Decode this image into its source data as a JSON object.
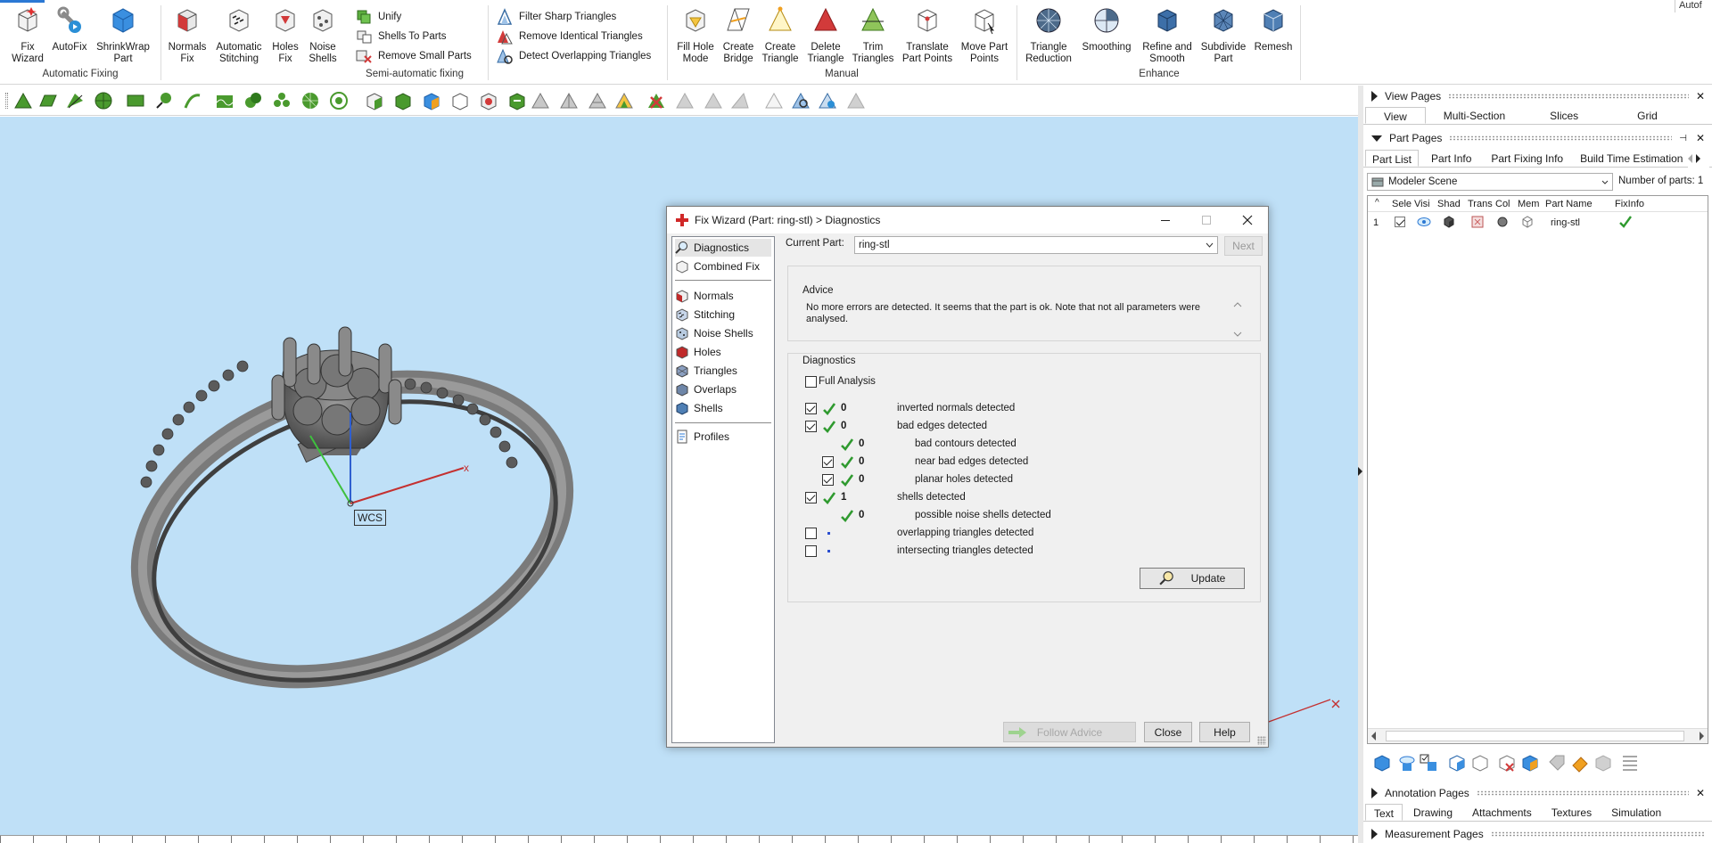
{
  "ribbon": {
    "corner_label": "Autof",
    "automatic": {
      "group_label": "Automatic Fixing",
      "fix_wizard": "Fix Wizard",
      "autofix": "AutoFix",
      "shrinkwrap": "ShrinkWrap Part"
    },
    "semi": {
      "group_label": "Semi-automatic fixing",
      "normals_fix": "Normals Fix",
      "auto_stitching": "Automatic Stitching",
      "holes_fix": "Holes Fix",
      "noise_shells": "Noise Shells",
      "unify": "Unify",
      "shells_to_parts": "Shells To Parts",
      "remove_small_parts": "Remove Small Parts",
      "filter_sharp": "Filter Sharp Triangles",
      "remove_identical": "Remove Identical Triangles",
      "detect_overlapping": "Detect Overlapping Triangles"
    },
    "manual": {
      "group_label": "Manual",
      "fill_hole_mode": "Fill Hole Mode",
      "create_bridge": "Create Bridge",
      "create_triangle": "Create Triangle",
      "delete_triangle": "Delete Triangle",
      "trim_triangles": "Trim Triangles",
      "translate_points": "Translate Part Points",
      "move_points": "Move Part Points"
    },
    "enhance": {
      "group_label": "Enhance",
      "triangle_reduction": "Triangle Reduction",
      "smoothing": "Smoothing",
      "refine_smooth": "Refine and Smooth",
      "subdivide": "Subdivide Part",
      "remesh": "Remesh"
    }
  },
  "viewport": {
    "wcs_label": "WCS",
    "x_axis_label": "x",
    "colors": {
      "background": "#bfe0f7",
      "ring": "#6e6e6e"
    }
  },
  "dialog": {
    "title": "Fix Wizard (Part: ring-stl) > Diagnostics",
    "nav": {
      "diagnostics": "Diagnostics",
      "combined_fix": "Combined Fix",
      "normals": "Normals",
      "stitching": "Stitching",
      "noise_shells": "Noise Shells",
      "holes": "Holes",
      "triangles": "Triangles",
      "overlaps": "Overlaps",
      "shells": "Shells",
      "profiles": "Profiles"
    },
    "current_part_label": "Current Part:",
    "current_part_value": "ring-stl",
    "next_label": "Next",
    "advice_label": "Advice",
    "advice_text": "No more errors are detected. It seems that the part is ok. Note that not all parameters were analysed.",
    "diagnostics_label": "Diagnostics",
    "full_analysis_label": "Full Analysis",
    "rows": [
      {
        "value": "0",
        "label": "inverted normals detected"
      },
      {
        "value": "0",
        "label": "bad edges detected"
      },
      {
        "value": "0",
        "label": "bad contours detected"
      },
      {
        "value": "0",
        "label": "near bad edges detected"
      },
      {
        "value": "0",
        "label": "planar holes detected"
      },
      {
        "value": "1",
        "label": "shells detected"
      },
      {
        "value": "0",
        "label": "possible noise shells detected"
      },
      {
        "value": "",
        "label": "overlapping triangles detected"
      },
      {
        "value": "",
        "label": "intersecting triangles detected"
      }
    ],
    "update_label": "Update",
    "follow_advice_label": "Follow Advice",
    "close_label": "Close",
    "help_label": "Help"
  },
  "right_panel": {
    "view_pages": {
      "header": "View Pages",
      "tabs": [
        "View",
        "Multi-Section",
        "Slices",
        "Grid"
      ]
    },
    "part_pages": {
      "header": "Part Pages",
      "tabs": [
        "Part List",
        "Part Info",
        "Part Fixing Info",
        "Build Time Estimation"
      ],
      "scene": "Modeler Scene",
      "num_parts_label": "Number of parts:",
      "num_parts_value": "1",
      "columns": [
        "Sele",
        "Visi",
        "Shad",
        "Trans",
        "Col",
        "Mem",
        "Part Name",
        "FixInfo"
      ],
      "row": {
        "index": "1",
        "name": "ring-stl"
      }
    },
    "annotation_pages": {
      "header": "Annotation Pages",
      "tabs": [
        "Text",
        "Drawing",
        "Attachments",
        "Textures",
        "Simulation"
      ]
    },
    "measurement_pages": {
      "header": "Measurement Pages"
    }
  }
}
